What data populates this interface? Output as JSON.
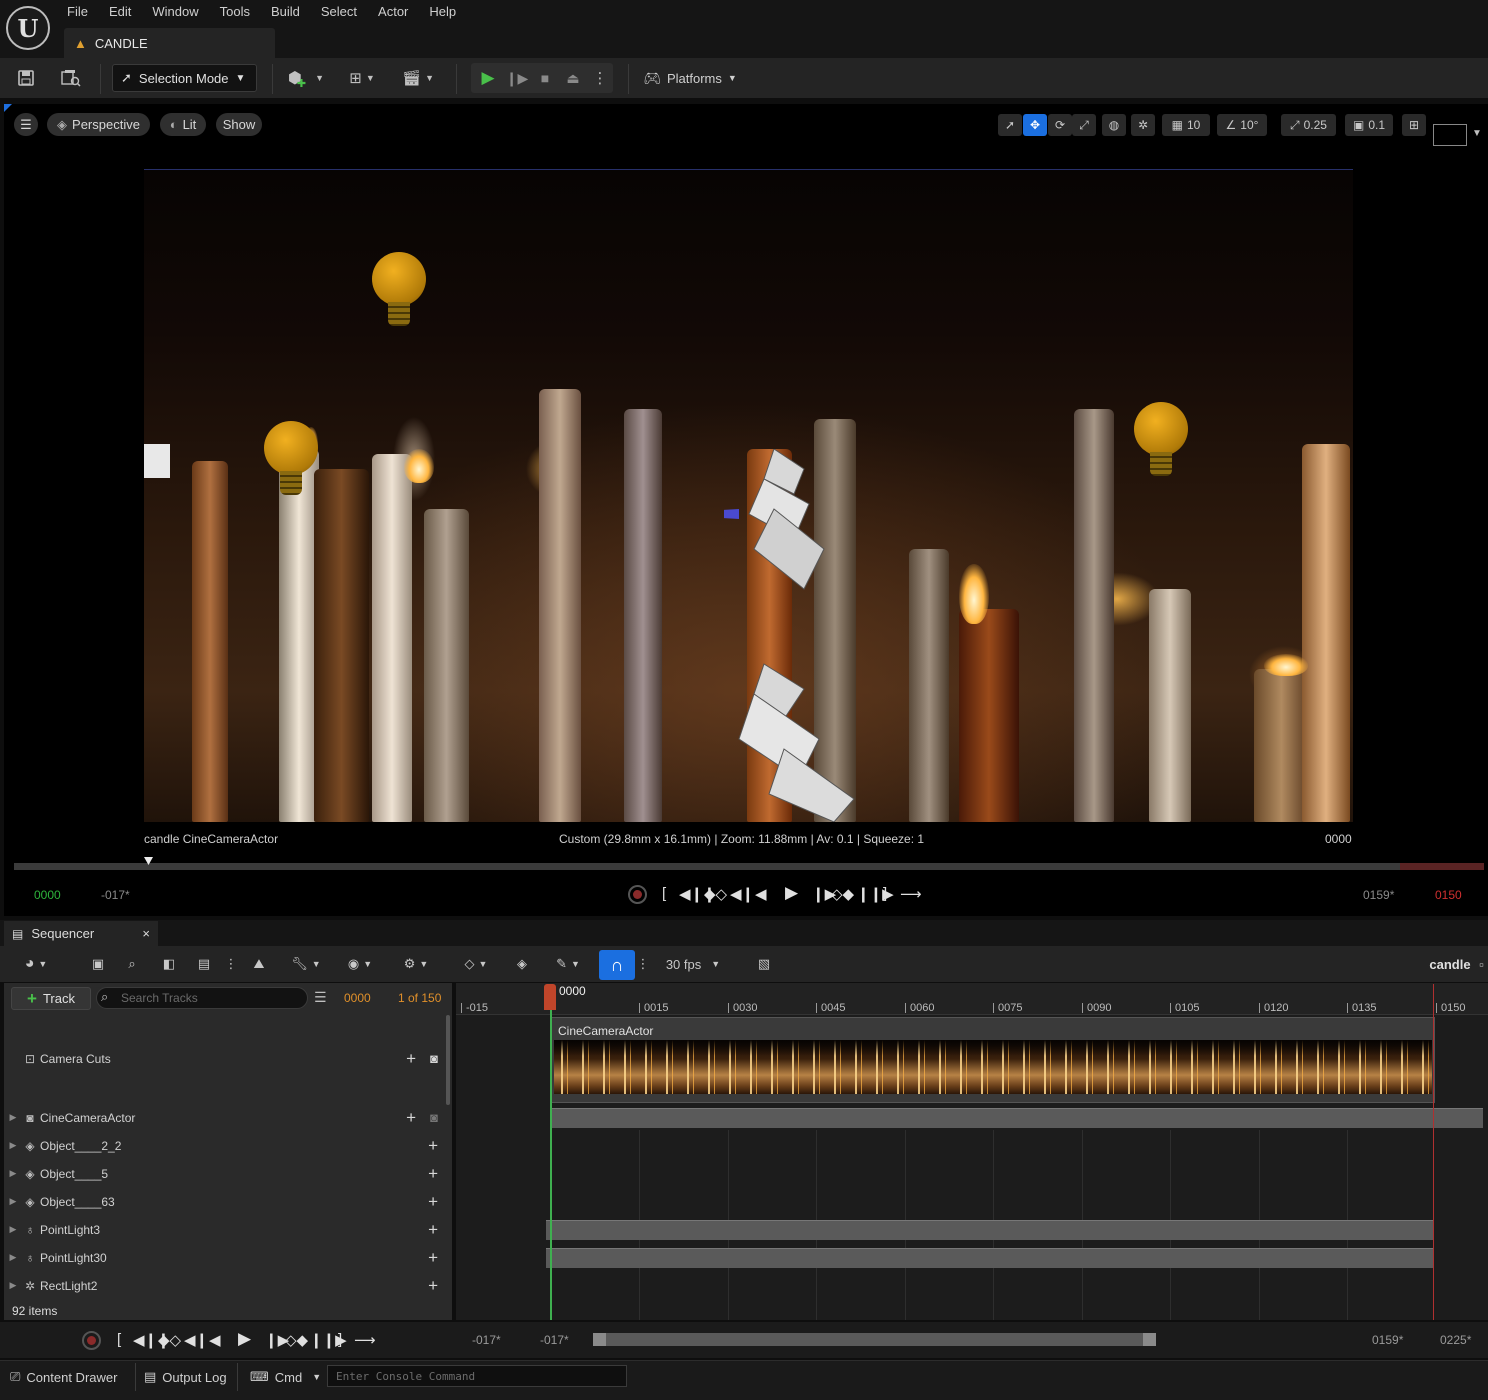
{
  "menu": [
    "File",
    "Edit",
    "Window",
    "Tools",
    "Build",
    "Select",
    "Actor",
    "Help"
  ],
  "document_tab": "CANDLE",
  "toolbar": {
    "mode": "Selection Mode",
    "platforms": "Platforms"
  },
  "viewport": {
    "perspective": "Perspective",
    "lit": "Lit",
    "show": "Show",
    "grid_snap": "10",
    "rotation_snap": "10°",
    "scale_snap": "0.25",
    "camera_speed": "0.1",
    "camera_name": "candle CineCameraActor",
    "camera_info": "Custom (29.8mm x 16.1mm) | Zoom: 11.88mm | Av: 0.1 | Squeeze: 1",
    "frame": "0000",
    "transport": {
      "current": "0000",
      "start_view": "-017*",
      "end_view": "0159*",
      "end": "0150"
    }
  },
  "sequencer": {
    "tab": "Sequencer",
    "fps": "30 fps",
    "sequence_name": "candle",
    "track_button": "Track",
    "search_placeholder": "Search Tracks",
    "current_frame": "0000",
    "frame_of": "1 of 150",
    "playhead_label": "0000",
    "ruler": [
      "-015",
      "0015",
      "0030",
      "0045",
      "0060",
      "0075",
      "0090",
      "0105",
      "0120",
      "0135",
      "0150"
    ],
    "camera_section_label": "CineCameraActor",
    "tracks": [
      {
        "name": "Camera Cuts",
        "icon": "camera-cuts-icon"
      },
      {
        "name": "CineCameraActor",
        "icon": "cine-camera-icon"
      },
      {
        "name": "Object____2_2",
        "icon": "static-mesh-icon"
      },
      {
        "name": "Object____5",
        "icon": "static-mesh-icon"
      },
      {
        "name": "Object____63",
        "icon": "static-mesh-icon"
      },
      {
        "name": "PointLight3",
        "icon": "point-light-icon"
      },
      {
        "name": "PointLight30",
        "icon": "point-light-icon"
      },
      {
        "name": "RectLight2",
        "icon": "rect-light-icon"
      }
    ],
    "items_count": "92 items",
    "bottom": {
      "view_start": "-017*",
      "work_start": "-017*",
      "view_end": "0159*",
      "work_end": "0225*"
    }
  },
  "statusbar": {
    "content_drawer": "Content Drawer",
    "output_log": "Output Log",
    "cmd": "Cmd",
    "console_placeholder": "Enter Console Command"
  },
  "colors": {
    "accent": "#1b6fe0",
    "play_green": "#49c04a",
    "playhead": "#c0452a",
    "current_frame": "#2db43b",
    "end_frame": "#d03030",
    "frame_orange": "#e0902a"
  }
}
